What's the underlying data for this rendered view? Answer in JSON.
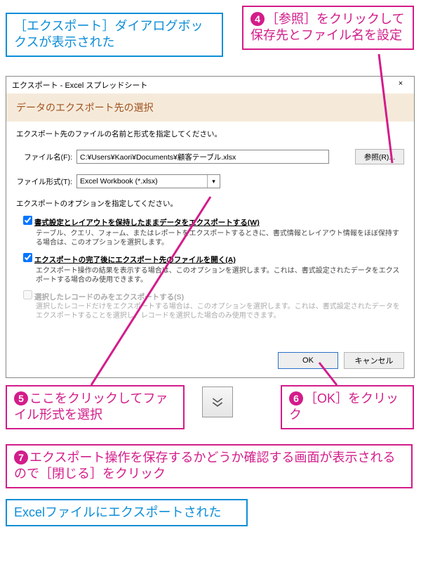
{
  "callouts": {
    "c1": "［エクスポート］ダイアログボックスが表示された",
    "c4": "［参照］をクリックして保存先とファイル名を設定",
    "c5": "ここをクリックしてファイル形式を選択",
    "c6": "［OK］をクリック",
    "c7": "エクスポート操作を保存するかどうか確認する画面が表示されるので［閉じる］をクリック",
    "c8": "Excelファイルにエクスポートされた",
    "n4": "4",
    "n5": "5",
    "n6": "6",
    "n7": "7"
  },
  "dialog": {
    "title": "エクスポート - Excel スプレッドシート",
    "close": "×",
    "subtitle": "データのエクスポート先の選択",
    "instr1": "エクスポート先のファイルの名前と形式を指定してください。",
    "filename_label": "ファイル名(F):",
    "filename_value": "C:¥Users¥Kaori¥Documents¥顧客テーブル.xlsx",
    "browse": "参照(R)...",
    "format_label": "ファイル形式(T):",
    "format_value": "Excel Workbook (*.xlsx)",
    "options_instr": "エクスポートのオプションを指定してください。",
    "opt1_label": "書式設定とレイアウトを保持したままデータをエクスポートする(W)",
    "opt1_desc": "テーブル、クエリ、フォーム、またはレポートをエクスポートするときに、書式情報とレイアウト情報をほぼ保持する場合は、このオプションを選択します。",
    "opt2_label": "エクスポートの完了後にエクスポート先のファイルを開く(A)",
    "opt2_desc": "エクスポート操作の結果を表示する場合は、このオプションを選択します。これは、書式設定されたデータをエクスポートする場合のみ使用できます。",
    "opt3_label": "選択したレコードのみをエクスポートする(S)",
    "opt3_desc": "選択したレコードだけをエクスポートする場合は、このオプションを選択します。これは、書式設定されたデータをエクスポートすることを選択し、レコードを選択した場合のみ使用できます。",
    "ok": "OK",
    "cancel": "キャンセル"
  }
}
